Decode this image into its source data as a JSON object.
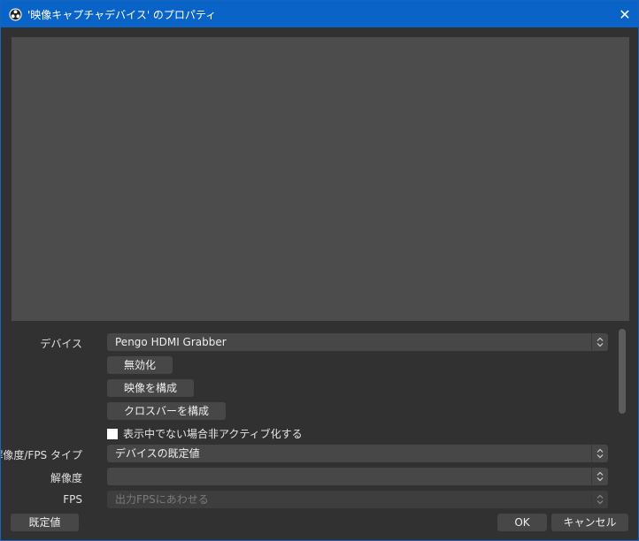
{
  "window": {
    "title": "'映像キャプチャデバイス' のプロパティ",
    "close_glyph": "✕",
    "title_bar_color": "#0a64c8"
  },
  "icons": {
    "app": "obs-logo-icon",
    "close": "close-icon",
    "select_arrows": "up-down-arrows-icon"
  },
  "form": {
    "device": {
      "label": "デバイス",
      "value": "Pengo HDMI Grabber"
    },
    "buttons": {
      "deactivate": "無効化",
      "configure_video": "映像を構成",
      "configure_crossbar": "クロスバーを構成"
    },
    "deactivate_when_hidden": {
      "label": "表示中でない場合非アクティブ化する",
      "checked": false
    },
    "resolution_fps_type": {
      "label": "解像度/FPS タイプ",
      "value": "デバイスの既定値"
    },
    "resolution": {
      "label": "解像度",
      "value": ""
    },
    "fps": {
      "label": "FPS",
      "value": "出力FPSにあわせる",
      "disabled": true
    }
  },
  "footer": {
    "defaults": "既定値",
    "ok": "OK",
    "cancel": "キャンセル"
  }
}
